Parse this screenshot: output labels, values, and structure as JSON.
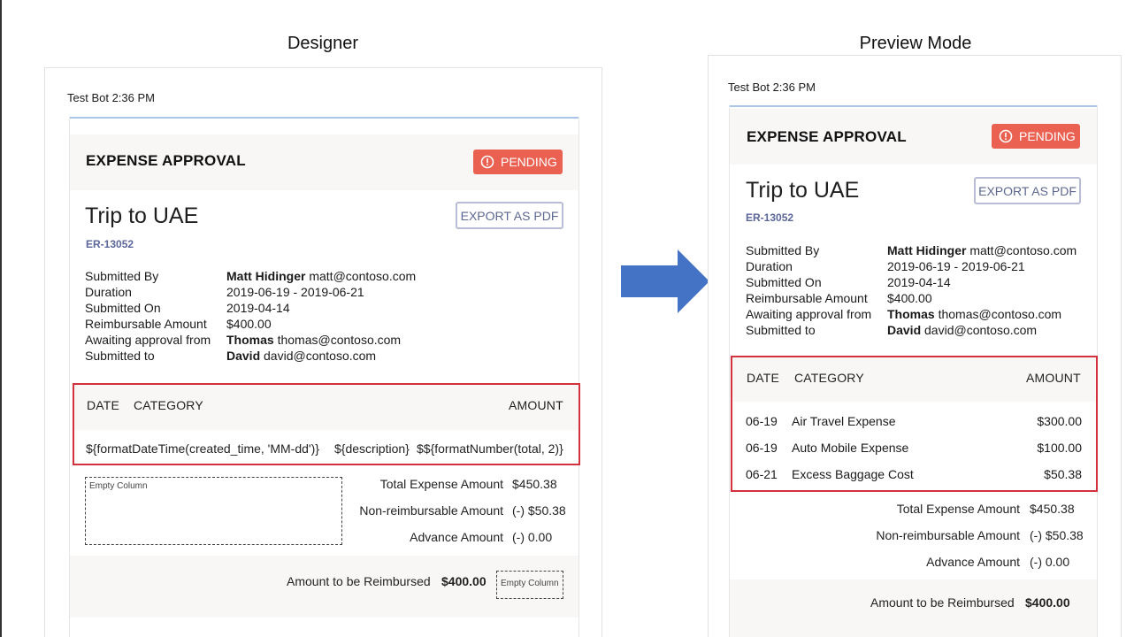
{
  "labels": {
    "designer": "Designer",
    "preview": "Preview Mode"
  },
  "colors": {
    "pending_badge": "#ea6152",
    "table_highlight_border": "#d4313f",
    "arrow": "#4472c4",
    "report_id": "#5b6699"
  },
  "designer": {
    "bot_line": "Test Bot 2:36 PM",
    "card": {
      "header_title": "EXPENSE APPROVAL",
      "status": "PENDING",
      "trip_title": "Trip to UAE",
      "report_id": "ER-13052",
      "export_label": "EXPORT AS PDF",
      "facts": [
        {
          "label": "Submitted By",
          "name": "Matt Hidinger",
          "value": " matt@contoso.com"
        },
        {
          "label": "Duration",
          "name": "",
          "value": "2019-06-19 - 2019-06-21"
        },
        {
          "label": "Submitted On",
          "name": "",
          "value": "2019-04-14"
        },
        {
          "label": "Reimbursable Amount",
          "name": "",
          "value": "$400.00"
        },
        {
          "label": "Awaiting approval from",
          "name": "Thomas",
          "value": " thomas@contoso.com"
        },
        {
          "label": "Submitted to",
          "name": "David",
          "value": " david@contoso.com"
        }
      ],
      "table": {
        "col_date": "DATE",
        "col_category": "CATEGORY",
        "col_amount": "AMOUNT",
        "template_date": "${formatDateTime(created_time, 'MM-dd')}",
        "template_description": "${description}",
        "template_amount": "$${formatNumber(total, 2)}"
      },
      "empty_column_label": "Empty Column",
      "summary": [
        {
          "label": "Total Expense Amount",
          "value": "$450.38"
        },
        {
          "label": "Non-reimbursable Amount",
          "value": "(-) $50.38"
        },
        {
          "label": "Advance Amount",
          "value": "(-) 0.00"
        }
      ],
      "reimbursed_label": "Amount to be Reimbursed",
      "reimbursed_value": "$400.00",
      "empty_column_label_2": "Empty Column"
    }
  },
  "preview": {
    "bot_line": "Test Bot 2:36 PM",
    "card": {
      "header_title": "EXPENSE APPROVAL",
      "status": "PENDING",
      "trip_title": "Trip to UAE",
      "report_id": "ER-13052",
      "export_label": "EXPORT AS PDF",
      "facts": [
        {
          "label": "Submitted By",
          "name": "Matt Hidinger",
          "value": " matt@contoso.com"
        },
        {
          "label": "Duration",
          "name": "",
          "value": "2019-06-19 - 2019-06-21"
        },
        {
          "label": "Submitted On",
          "name": "",
          "value": "2019-04-14"
        },
        {
          "label": "Reimbursable Amount",
          "name": "",
          "value": "$400.00"
        },
        {
          "label": "Awaiting approval from",
          "name": "Thomas",
          "value": " thomas@contoso.com"
        },
        {
          "label": "Submitted to",
          "name": "David",
          "value": " david@contoso.com"
        }
      ],
      "table": {
        "col_date": "DATE",
        "col_category": "CATEGORY",
        "col_amount": "AMOUNT",
        "rows": [
          {
            "date": "06-19",
            "category": "Air Travel Expense",
            "amount": "$300.00"
          },
          {
            "date": "06-19",
            "category": "Auto Mobile Expense",
            "amount": "$100.00"
          },
          {
            "date": "06-21",
            "category": "Excess Baggage Cost",
            "amount": "$50.38"
          }
        ]
      },
      "summary": [
        {
          "label": "Total Expense Amount",
          "value": "$450.38"
        },
        {
          "label": "Non-reimbursable Amount",
          "value": "(-) $50.38"
        },
        {
          "label": "Advance Amount",
          "value": "(-) 0.00"
        }
      ],
      "reimbursed_label": "Amount to be Reimbursed",
      "reimbursed_value": "$400.00"
    }
  }
}
